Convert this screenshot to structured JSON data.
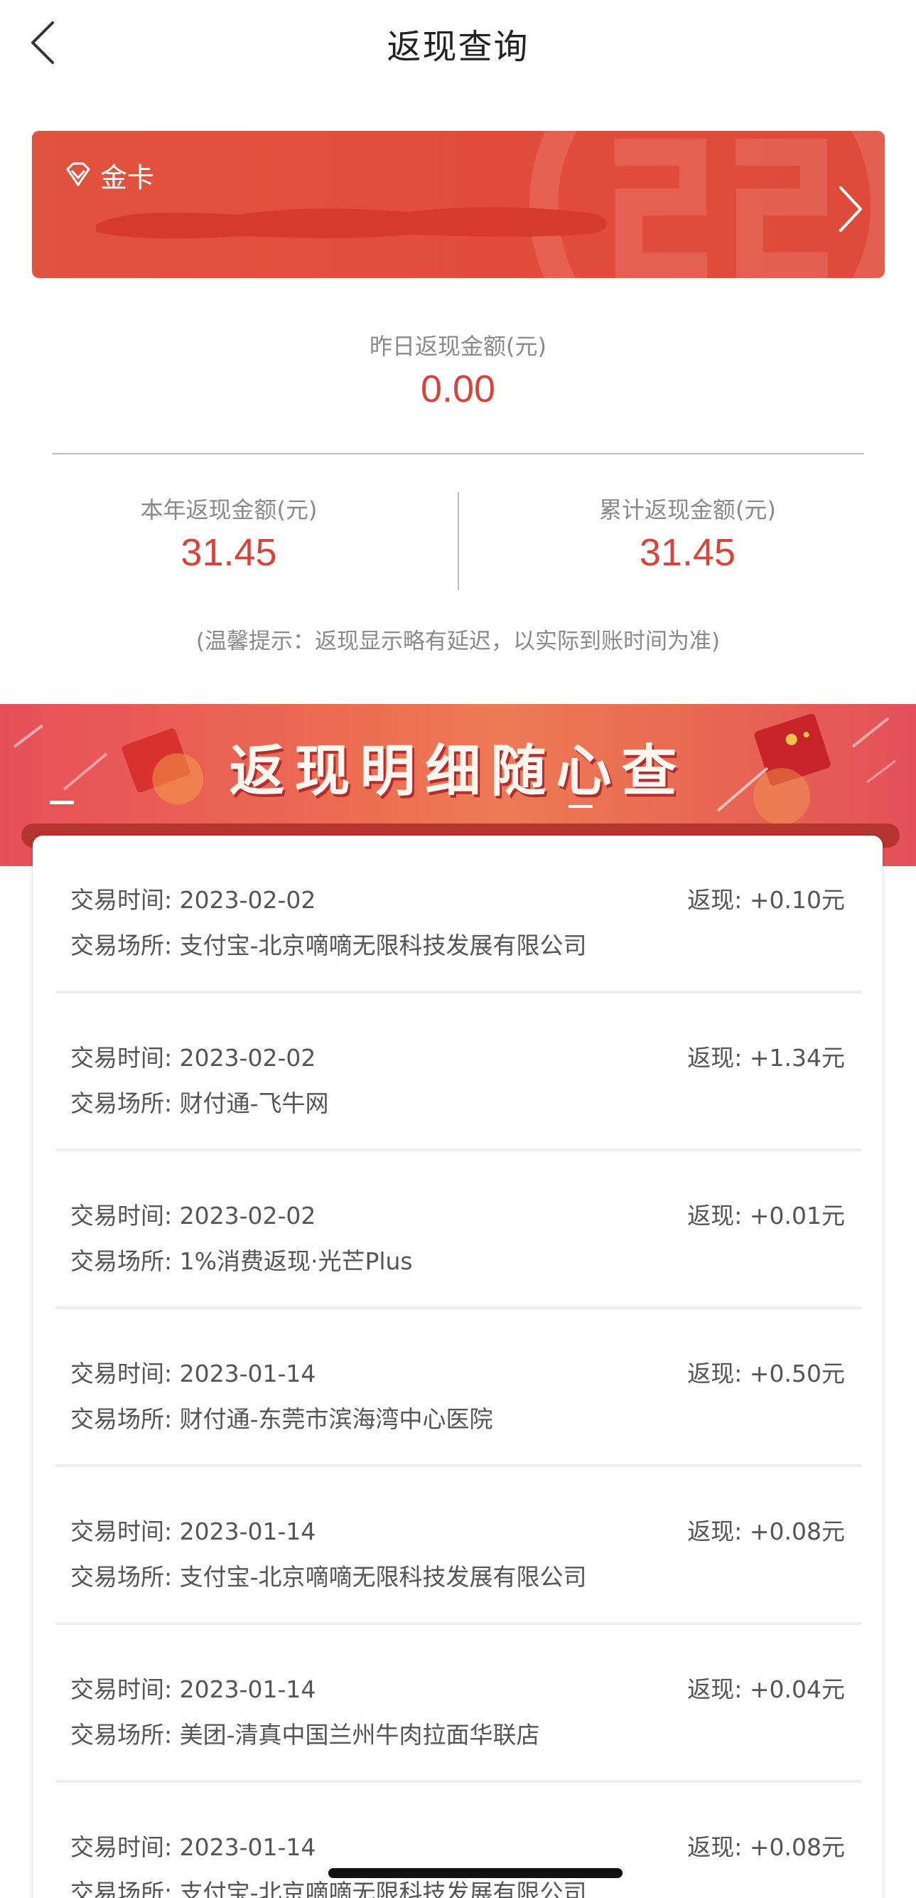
{
  "header": {
    "title": "返现查询"
  },
  "card": {
    "tier": "金卡"
  },
  "stats": {
    "yesterday_label": "昨日返现金额(元)",
    "yesterday_value": "0.00",
    "year_label": "本年返现金额(元)",
    "year_value": "31.45",
    "total_label": "累计返现金额(元)",
    "total_value": "31.45",
    "notice": "(温馨提示：返现显示略有延迟，以实际到账时间为准)"
  },
  "banner": {
    "title": "返现明细随心查"
  },
  "transactions": [
    {
      "time": "交易时间: 2023-02-02",
      "amount": "返现: +0.10元",
      "place": "交易场所: 支付宝-北京嘀嘀无限科技发展有限公司"
    },
    {
      "time": "交易时间: 2023-02-02",
      "amount": "返现: +1.34元",
      "place": "交易场所: 财付通-飞牛网"
    },
    {
      "time": "交易时间: 2023-02-02",
      "amount": "返现: +0.01元",
      "place": "交易场所: 1%消费返现·光芒Plus"
    },
    {
      "time": "交易时间: 2023-01-14",
      "amount": "返现: +0.50元",
      "place": "交易场所: 财付通-东莞市滨海湾中心医院"
    },
    {
      "time": "交易时间: 2023-01-14",
      "amount": "返现: +0.08元",
      "place": "交易场所: 支付宝-北京嘀嘀无限科技发展有限公司"
    },
    {
      "time": "交易时间: 2023-01-14",
      "amount": "返现: +0.04元",
      "place": "交易场所: 美团-清真中国兰州牛肉拉面华联店"
    },
    {
      "time": "交易时间: 2023-01-14",
      "amount": "返现: +0.08元",
      "place": "交易场所: 支付宝-北京嘀嘀无限科技发展有限公司"
    }
  ],
  "colors": {
    "accent_red": "#d9443a",
    "card_red": "#e34c3b"
  }
}
